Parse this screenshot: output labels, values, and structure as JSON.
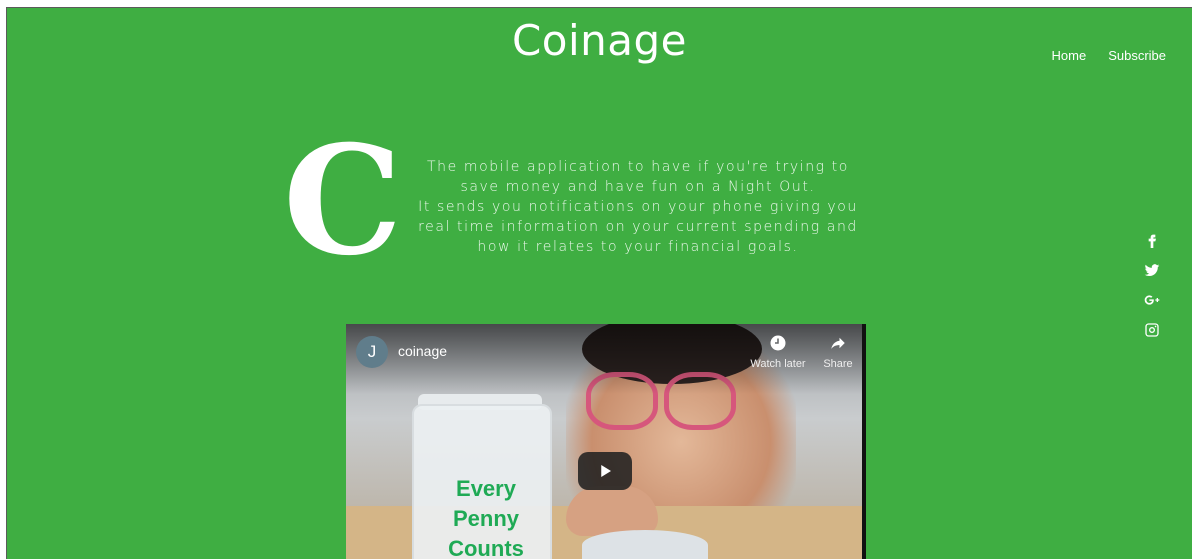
{
  "header": {
    "brand": "Coinage",
    "nav": [
      {
        "label": "Home"
      },
      {
        "label": "Subscribe"
      }
    ]
  },
  "intro": {
    "dropcap": "C",
    "lines": [
      "The mobile application to have if you're trying to",
      "save money and have fun on a Night Out.",
      "It sends you notifications on your phone giving you",
      "real time information on your current spending and",
      "how it relates to your financial goals."
    ]
  },
  "social": [
    "facebook-icon",
    "twitter-icon",
    "google-plus-icon",
    "instagram-icon"
  ],
  "video": {
    "channel_initial": "J",
    "title": "coinage",
    "watch_later": "Watch later",
    "share": "Share",
    "jar_text": [
      "Every",
      "Penny",
      "Counts"
    ]
  },
  "colors": {
    "background": "#3fae42",
    "text": "#ffffff"
  }
}
